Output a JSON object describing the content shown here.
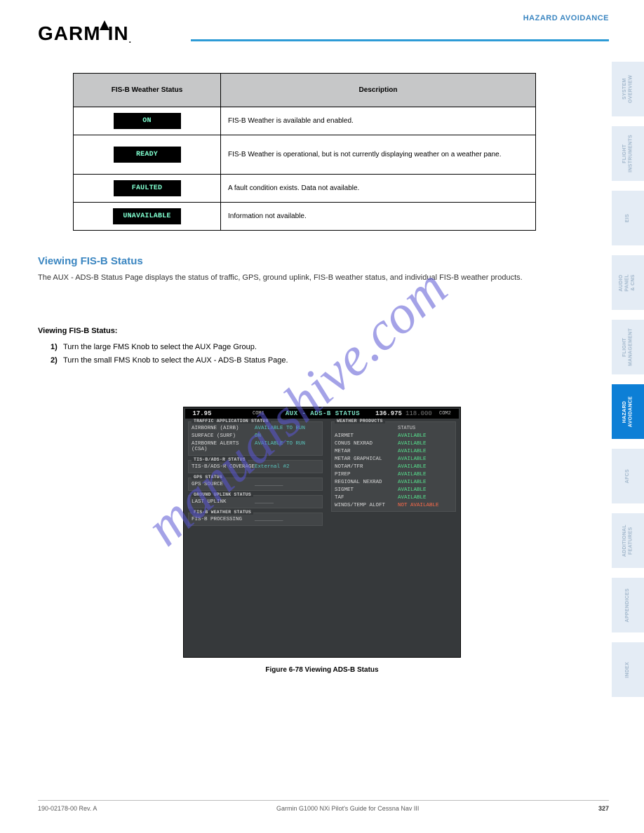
{
  "header": {
    "brand_g": "G",
    "brand_a": "A",
    "brand_r": "R",
    "brand_m": "M",
    "brand_i": "I",
    "brand_n": "N",
    "brand_dot": ".",
    "title": "HAZARD AVOIDANCE"
  },
  "table": {
    "head_status": "FIS-B Weather Status",
    "head_desc": "Description",
    "rows": [
      {
        "status": "ON",
        "desc": "FIS-B Weather is available and enabled."
      },
      {
        "status": "READY",
        "desc": "FIS-B Weather is operational, but is not currently displaying weather on a weather pane."
      },
      {
        "status": "FAULTED",
        "desc": "A fault condition exists. Data not available."
      },
      {
        "status": "UNAVAILABLE",
        "desc": "Information not available."
      }
    ]
  },
  "section": {
    "title": "Viewing FIS-B Status",
    "para1": "The AUX - ADS-B Status Page displays the status of traffic, GPS, ground uplink, FIS-B weather status, and individual FIS-B weather products.",
    "steps_title": "Viewing FIS-B Status:",
    "step1_n": "1)",
    "step1_t": "Turn the large FMS Knob to select the AUX Page Group.",
    "step2_n": "2)",
    "step2_t": "Turn the small FMS Knob to select the AUX - ADS-B Status Page.",
    "fig_caption": "Figure 6-78  Viewing ADS-B Status"
  },
  "device": {
    "freq1": "17.95",
    "freq1b": "",
    "com1": "COM1",
    "center": "AUX - ADS-B STATUS",
    "freq2": "136.975",
    "freq2b": "118.000",
    "com2": "COM2",
    "panel_traffic": "TRAFFIC APPLICATION STATUS",
    "traffic": [
      {
        "lab": "AIRBORNE (AIRB)",
        "val": "AVAILABLE TO RUN",
        "cls": "c-cyan"
      },
      {
        "lab": "SURFACE (SURF)",
        "val": "ON",
        "cls": "c-green"
      },
      {
        "lab": "AIRBORNE ALERTS (CSA)",
        "val": "AVAILABLE TO RUN",
        "cls": "c-cyan"
      }
    ],
    "panel_tisb": "TIS-B/ADS-R STATUS",
    "tisb": [
      {
        "lab": "TIS-B/ADS-R COVERAGE",
        "val": "External #2",
        "cls": "c-cyan"
      }
    ],
    "panel_gps": "GPS STATUS",
    "gps": [
      {
        "lab": "GPS SOURCE",
        "val": "_________",
        "cls": "c-grey"
      }
    ],
    "panel_uplink": "GROUND UPLINK STATUS",
    "uplink": [
      {
        "lab": "LAST UPLINK",
        "val": "______",
        "cls": "c-grey"
      }
    ],
    "panel_fisb": "FIS-B WEATHER STATUS",
    "fisb": [
      {
        "lab": "FIS-B PROCESSING",
        "val": "_________",
        "cls": "c-grey"
      }
    ],
    "panel_wx": "WEATHER PRODUCTS",
    "wx_status_hdr": "STATUS",
    "wx": [
      {
        "lab": "AIRMET",
        "val": "AVAILABLE",
        "cls": "c-green"
      },
      {
        "lab": "CONUS NEXRAD",
        "val": "AVAILABLE",
        "cls": "c-green"
      },
      {
        "lab": "METAR",
        "val": "AVAILABLE",
        "cls": "c-green"
      },
      {
        "lab": "METAR GRAPHICAL",
        "val": "AVAILABLE",
        "cls": "c-green"
      },
      {
        "lab": "NOTAM/TFR",
        "val": "AVAILABLE",
        "cls": "c-green"
      },
      {
        "lab": "PIREP",
        "val": "AVAILABLE",
        "cls": "c-green"
      },
      {
        "lab": "REGIONAL NEXRAD",
        "val": "AVAILABLE",
        "cls": "c-green"
      },
      {
        "lab": "SIGMET",
        "val": "AVAILABLE",
        "cls": "c-green"
      },
      {
        "lab": "TAF",
        "val": "AVAILABLE",
        "cls": "c-green"
      },
      {
        "lab": "WINDS/TEMP ALOFT",
        "val": "NOT AVAILABLE",
        "cls": "c-red"
      }
    ]
  },
  "tabs": [
    "SYSTEM\nOVERVIEW",
    "FLIGHT\nINSTRUMENTS",
    "EIS",
    "AUDIO\nPANEL\n& CNS",
    "FLIGHT\nMANAGEMENT",
    "HAZARD\nAVOIDANCE",
    "AFCS",
    "ADDITIONAL\nFEATURES",
    "APPENDICES",
    "INDEX"
  ],
  "active_tab_index": 5,
  "footer": {
    "left": "190-02178-00  Rev. A",
    "center": "Garmin G1000 NXi Pilot's Guide for Cessna Nav III",
    "page": "327"
  }
}
